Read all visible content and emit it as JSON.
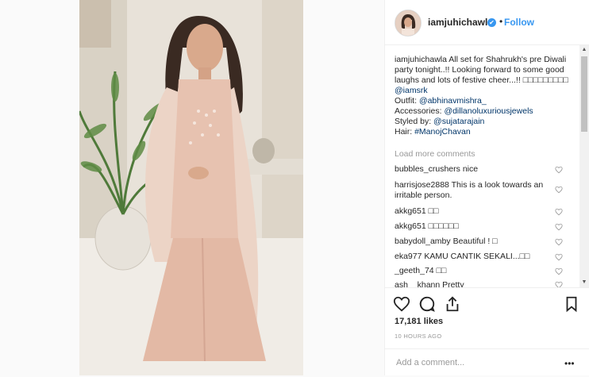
{
  "post": {
    "username": "iamjuhichawla",
    "verified_badge": "✔",
    "dot": "•",
    "follow_label": "Follow"
  },
  "caption": {
    "username": "iamjuhichawla",
    "text_line1": "All set for Shahrukh's pre Diwali party tonight..!! Looking forward to some good laughs and lots of festive cheer...!! ",
    "boxes": "□□□□□□□□□",
    "mention_srk": "@iamsrk",
    "outfit_label": "Outfit: ",
    "outfit_link": "@abhinavmishra_",
    "accessories_label": "Accessories: ",
    "accessories_link": "@dillanoluxuriousjewels",
    "styled_label": "Styled by: ",
    "styled_link": "@sujatarajain",
    "hair_label": "Hair: ",
    "hair_link": "#ManojChavan"
  },
  "load_more": "Load more comments",
  "comments": [
    {
      "user": "bubbles_crushers",
      "text": "nice"
    },
    {
      "user": "harrisjose2888",
      "text": "This is a look towards an irritable person."
    },
    {
      "user": "akkg651",
      "text": "□□"
    },
    {
      "user": "akkg651",
      "text": "□□□□□□"
    },
    {
      "user": "babydoll_amby",
      "text": "Beautiful ! □"
    },
    {
      "user": "eka977",
      "text": "KAMU CANTIK SEKALI...□□"
    },
    {
      "user": "_geeth_74",
      "text": "□□"
    },
    {
      "user": "ash__khann",
      "text": "Pretty"
    }
  ],
  "likes": "17,181 likes",
  "timestamp": "10 HOURS AGO",
  "add_comment_placeholder": "Add a comment...",
  "more_label": "•••",
  "icons": {
    "like": "heart-icon",
    "comment": "comment-icon",
    "share": "share-icon",
    "save": "bookmark-icon"
  },
  "colors": {
    "link": "#003569",
    "follow": "#3897f0",
    "muted": "#999999"
  }
}
